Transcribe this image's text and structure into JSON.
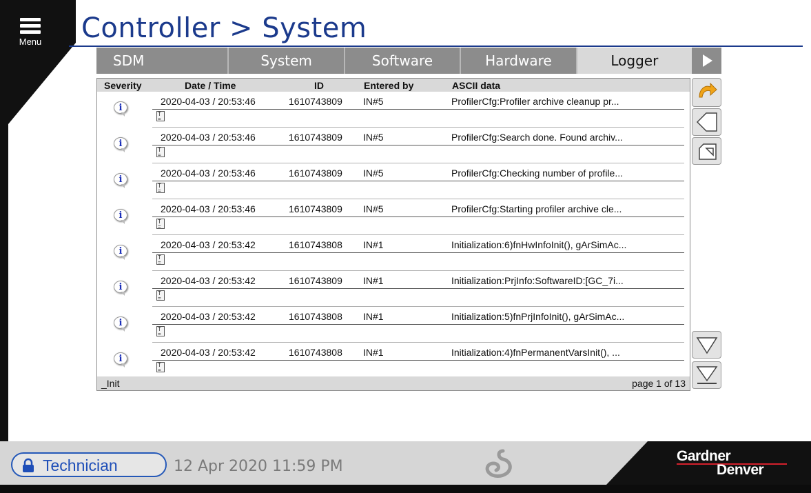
{
  "menu": {
    "label": "Menu"
  },
  "page": {
    "title": "Controller > System"
  },
  "tabs": [
    {
      "label": "SDM"
    },
    {
      "label": "System"
    },
    {
      "label": "Software"
    },
    {
      "label": "Hardware"
    },
    {
      "label": "Logger",
      "active": true
    }
  ],
  "log": {
    "columns": {
      "severity": "Severity",
      "datetime": "Date / Time",
      "id": "ID",
      "entered_by": "Entered by",
      "ascii": "ASCII data"
    },
    "rows": [
      {
        "severity": "info",
        "datetime": "2020-04-03 / 20:53:46",
        "id": "1610743809",
        "entered_by": "IN#5",
        "ascii": "ProfilerCfg:Profiler archive cleanup pr..."
      },
      {
        "severity": "info",
        "datetime": "2020-04-03 / 20:53:46",
        "id": "1610743809",
        "entered_by": "IN#5",
        "ascii": "ProfilerCfg:Search done. Found archiv..."
      },
      {
        "severity": "info",
        "datetime": "2020-04-03 / 20:53:46",
        "id": "1610743809",
        "entered_by": "IN#5",
        "ascii": "ProfilerCfg:Checking number of profile..."
      },
      {
        "severity": "info",
        "datetime": "2020-04-03 / 20:53:46",
        "id": "1610743809",
        "entered_by": "IN#5",
        "ascii": "ProfilerCfg:Starting profiler archive cle..."
      },
      {
        "severity": "info",
        "datetime": "2020-04-03 / 20:53:42",
        "id": "1610743808",
        "entered_by": "IN#1",
        "ascii": "Initialization:6)fnHwInfoInit(), gArSimAc..."
      },
      {
        "severity": "info",
        "datetime": "2020-04-03 / 20:53:42",
        "id": "1610743809",
        "entered_by": "IN#1",
        "ascii": "Initialization:PrjInfo:SoftwareID:[GC_7i..."
      },
      {
        "severity": "info",
        "datetime": "2020-04-03 / 20:53:42",
        "id": "1610743808",
        "entered_by": "IN#1",
        "ascii": "Initialization:5)fnPrjInfoInit(), gArSimAc..."
      },
      {
        "severity": "info",
        "datetime": "2020-04-03 / 20:53:42",
        "id": "1610743808",
        "entered_by": "IN#1",
        "ascii": "Initialization:4)fnPermanentVarsInit(), ..."
      }
    ],
    "footer": {
      "filter": "_Init",
      "page": "page 1 of 13"
    }
  },
  "icons": {
    "refresh": "refresh-arrow-icon",
    "back": "back-arrow-icon",
    "export": "export-icon",
    "scroll_down": "scroll-down-icon",
    "scroll_end": "scroll-end-icon",
    "info": "info-icon",
    "detail": "detail-document-icon",
    "lock": "lock-icon"
  },
  "status": {
    "role": "Technician",
    "datetime": "12 Apr 2020  11:59 PM"
  },
  "brand": {
    "line1": "Gardner",
    "line2": "Denver"
  },
  "colors": {
    "title": "#1b3a8c",
    "accent": "#2458b8",
    "tab": "#8c8c8c",
    "tab_active": "#d9d9d9",
    "brand_red": "#d4202c"
  }
}
